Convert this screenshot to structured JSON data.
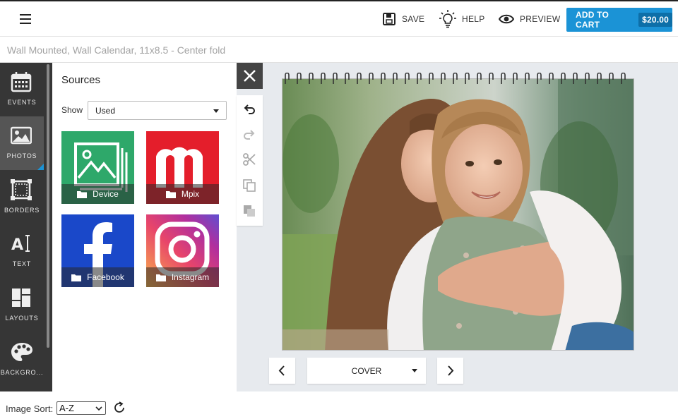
{
  "header": {
    "save_label": "SAVE",
    "help_label": "HELP",
    "preview_label": "PREVIEW",
    "add_to_cart_label": "ADD TO CART",
    "price": "$20.00",
    "icons": {
      "menu": "hamburger-icon",
      "save": "floppy-disk-icon",
      "help": "lightbulb-icon",
      "preview": "eye-icon"
    }
  },
  "project_title": "Wall Mounted, Wall Calendar, 11x8.5 - Center fold",
  "sidebar": {
    "items": [
      {
        "label": "EVENTS",
        "icon": "calendar-icon",
        "active": false
      },
      {
        "label": "PHOTOS",
        "icon": "photo-icon",
        "active": true
      },
      {
        "label": "BORDERS",
        "icon": "border-frame-icon",
        "active": false
      },
      {
        "label": "TEXT",
        "icon": "text-cursor-icon",
        "active": false
      },
      {
        "label": "LAYOUTS",
        "icon": "layout-grid-icon",
        "active": false
      },
      {
        "label": "BACKGRO...",
        "icon": "palette-icon",
        "active": false
      }
    ]
  },
  "sources": {
    "title": "Sources",
    "show_label": "Show",
    "show_value": "Used",
    "tiles": [
      {
        "label": "Device",
        "color": "#2ea86a"
      },
      {
        "label": "Mpix",
        "color": "#e41e2b"
      },
      {
        "label": "Facebook",
        "color": "#1a48c9"
      },
      {
        "label": "Instagram",
        "color": "#c8357f"
      }
    ]
  },
  "toolbar": {
    "icons": [
      "close-icon",
      "undo-icon",
      "redo-icon",
      "cut-icon",
      "copy-icon",
      "paste-icon"
    ]
  },
  "pager": {
    "current_page": "COVER",
    "icons": {
      "prev": "chevron-left-icon",
      "next": "chevron-right-icon"
    }
  },
  "footer": {
    "sort_label": "Image Sort:",
    "sort_value": "A-Z",
    "refresh_icon": "refresh-icon"
  },
  "colors": {
    "accent": "#1b93d6",
    "sidebar_bg": "#363636"
  }
}
